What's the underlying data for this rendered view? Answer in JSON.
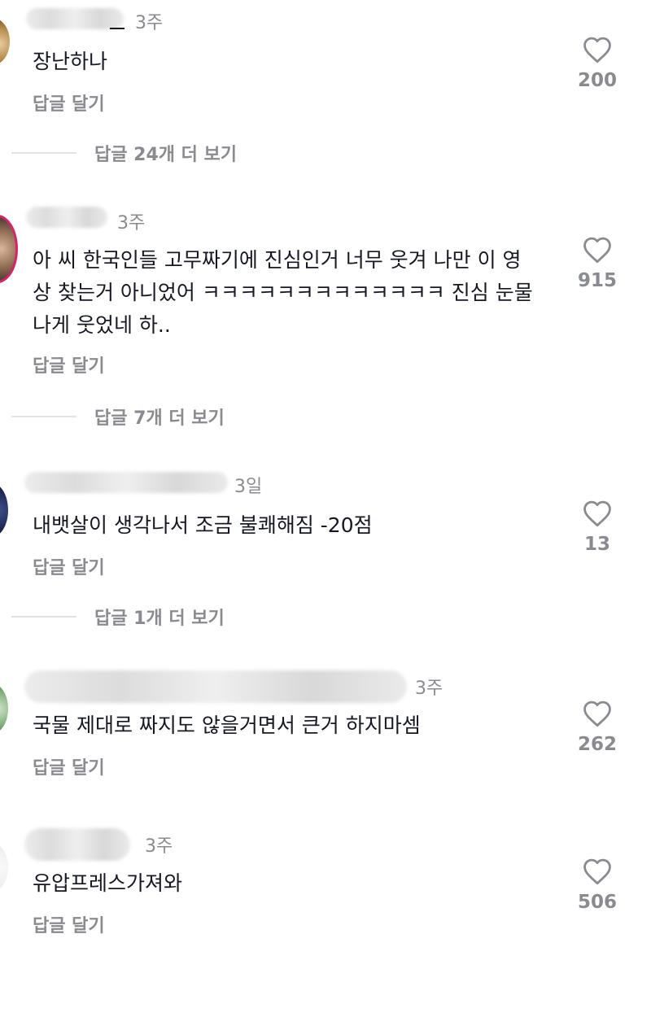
{
  "comments": [
    {
      "time": "3주",
      "text": "장난하나",
      "reply_label": "답글 달기",
      "likes": "200",
      "more_replies": "답글 24개 더 보기"
    },
    {
      "time": "3주",
      "text": "아 씨 한국인들 고무짜기에 진심인거 너무 웃겨 나만 이 영상 찾는거 아니었어 ㅋㅋㅋㅋㅋㅋㅋㅋㅋㅋㅋㅋㅋ 진심 눈물나게 웃었네 하..",
      "reply_label": "답글 달기",
      "likes": "915",
      "more_replies": "답글 7개 더 보기"
    },
    {
      "time": "3일",
      "text": "내뱃살이 생각나서 조금 불쾌해짐 -20점",
      "reply_label": "답글 달기",
      "likes": "13",
      "more_replies": "답글 1개 더 보기"
    },
    {
      "time": "3주",
      "text": "국물 제대로 짜지도 않을거면서 큰거 하지마셈",
      "reply_label": "답글 달기",
      "likes": "262"
    },
    {
      "time": "3주",
      "text": "유압프레스가져와",
      "reply_label": "답글 달기",
      "likes": "506"
    }
  ],
  "icons": {
    "like": "heart-outline-icon"
  },
  "colors": {
    "text": "#161823",
    "secondary": "#8a8b91",
    "divider": "#e3e3e4"
  }
}
